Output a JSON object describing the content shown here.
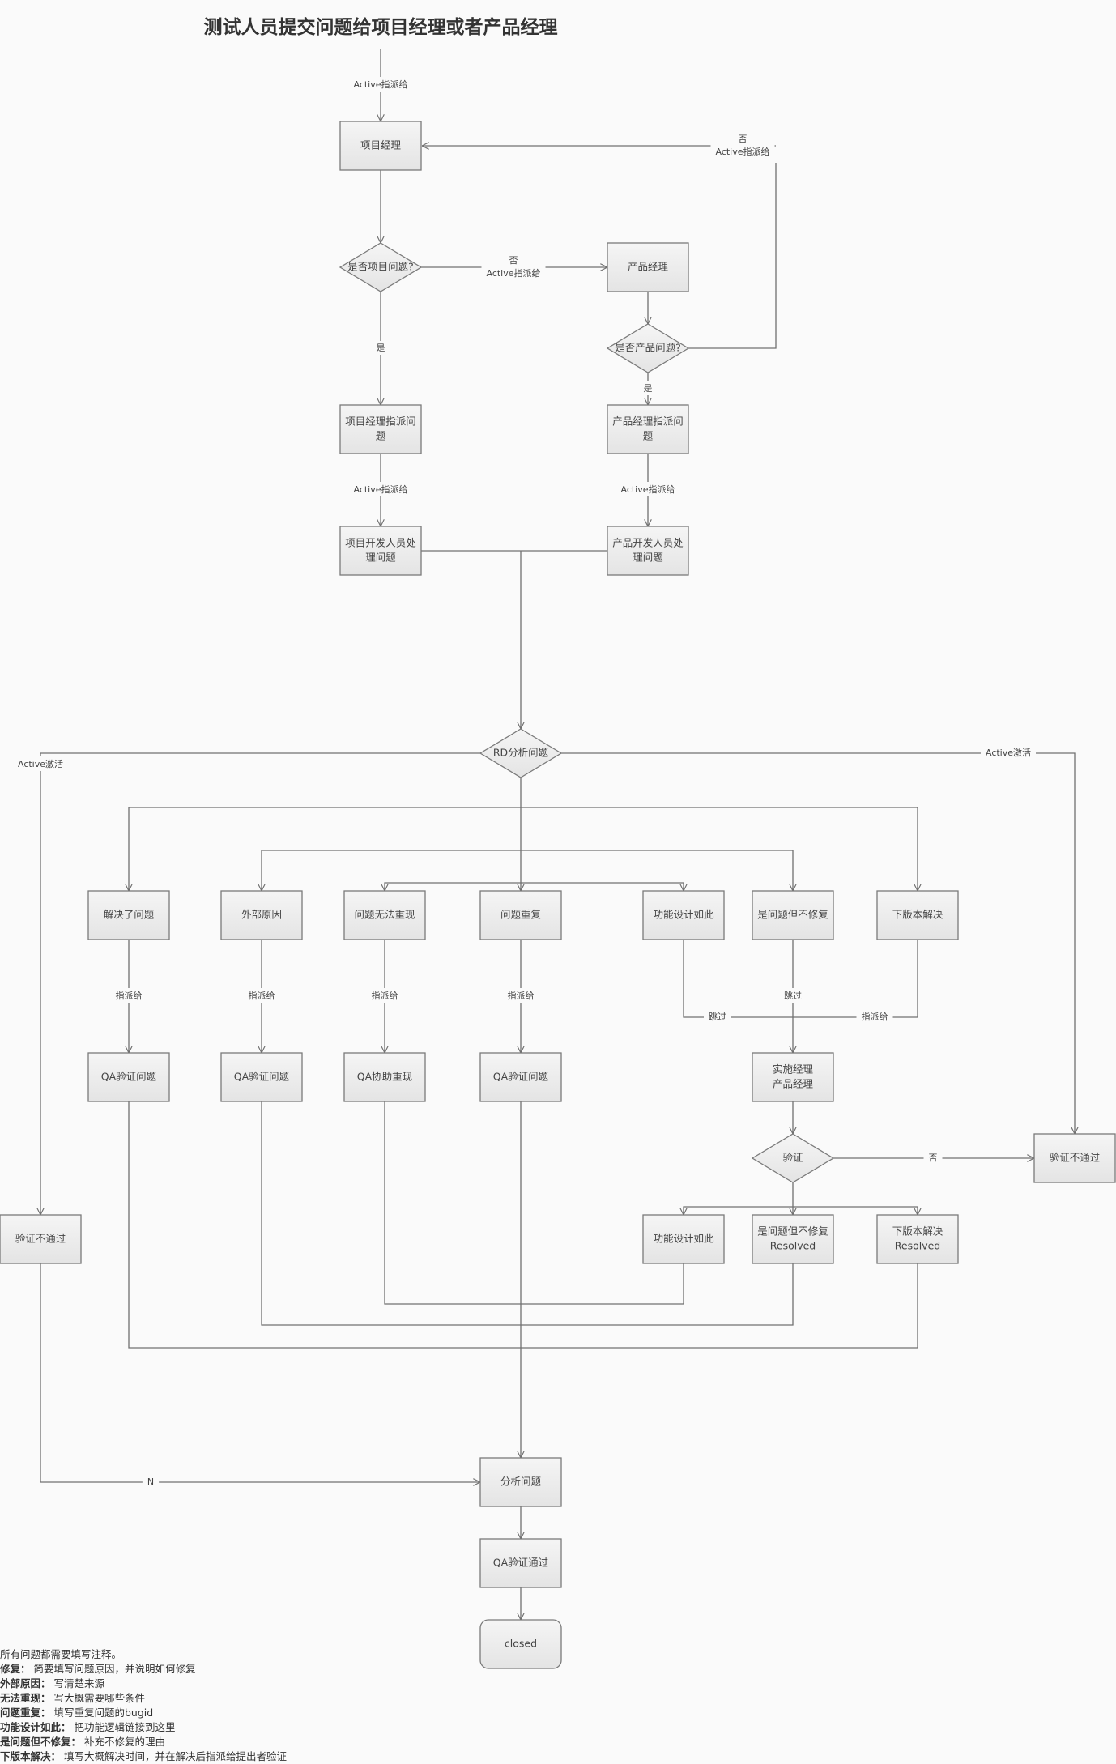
{
  "title": "测试人员提交问题给项目经理或者产品经理",
  "nodes": {
    "pm_project": {
      "label": "项目经理"
    },
    "is_project_issue": {
      "label": "是否项目问题?"
    },
    "pm_product": {
      "label": "产品经理"
    },
    "is_product_issue": {
      "label": "是否产品问题?"
    },
    "project_assign": {
      "label": "项目经理指派问题",
      "lines": [
        "项目经理指派问",
        "题"
      ]
    },
    "product_assign": {
      "label": "产品经理指派问题",
      "lines": [
        "产品经理指派问",
        "题"
      ]
    },
    "project_dev": {
      "label": "项目开发人员处理问题",
      "lines": [
        "项目开发人员处",
        "理问题"
      ]
    },
    "product_dev": {
      "label": "产品开发人员处理问题",
      "lines": [
        "产品开发人员处",
        "理问题"
      ]
    },
    "rd_analysis": {
      "label": "RD分析问题"
    },
    "resolved": {
      "label": "解决了问题"
    },
    "external": {
      "label": "外部原因"
    },
    "cannot_reproduce": {
      "label": "问题无法重现"
    },
    "duplicate": {
      "label": "问题重复"
    },
    "by_design": {
      "label": "功能设计如此"
    },
    "wont_fix": {
      "label": "是问题但不修复"
    },
    "next_version": {
      "label": "下版本解决"
    },
    "qa_verify_1": {
      "label": "QA验证问题"
    },
    "qa_verify_2": {
      "label": "QA验证问题"
    },
    "qa_reproduce": {
      "label": "QA协助重现"
    },
    "qa_verify_4": {
      "label": "QA验证问题"
    },
    "impl_manager": {
      "label": "实施经理 产品经理",
      "lines": [
        "实施经理",
        "产品经理"
      ]
    },
    "verify": {
      "label": "验证"
    },
    "verify_fail_right": {
      "label": "验证不通过"
    },
    "verify_fail_left": {
      "label": "验证不通过"
    },
    "by_design_2": {
      "label": "功能设计如此"
    },
    "wont_fix_resolved": {
      "label": "是问题但不修复 Resolved",
      "lines": [
        "是问题但不修复",
        "Resolved"
      ]
    },
    "next_version_resolved": {
      "label": "下版本解决 Resolved",
      "lines": [
        "下版本解决",
        "Resolved"
      ]
    },
    "analyze": {
      "label": "分析问题"
    },
    "qa_pass": {
      "label": "QA验证通过"
    },
    "closed": {
      "label": "closed"
    }
  },
  "edge_labels": {
    "start": "Active指派给",
    "project_no_1": "否",
    "project_no_2": "Active指派给",
    "product_no_1": "否",
    "product_no_2": "Active指派给",
    "project_yes": "是",
    "product_yes": "是",
    "project_assign_to": "Active指派给",
    "product_assign_to": "Active指派给",
    "reactivate_left": "Active激活",
    "reactivate_right": "Active激活",
    "assign_1": "指派给",
    "assign_2": "指派给",
    "assign_3": "指派给",
    "assign_4": "指派给",
    "skip_by_design": "跳过",
    "skip_wont_fix": "跳过",
    "assign_next_version": "指派给",
    "verify_no": "否",
    "reopen_n": "N"
  },
  "notes": {
    "intro": "所有问题都需要填写注释。",
    "items": [
      {
        "key": "修复",
        "text": "简要填写问题原因，并说明如何修复"
      },
      {
        "key": "外部原因",
        "text": "写清楚来源"
      },
      {
        "key": "无法重现",
        "text": "写大概需要哪些条件"
      },
      {
        "key": "问题重复",
        "text": "填写重复问题的bugid"
      },
      {
        "key": "功能设计如此",
        "text": "把功能逻辑链接到这里"
      },
      {
        "key": "是问题但不修复",
        "text": "补充不修复的理由"
      },
      {
        "key": "下版本解决",
        "text": "填写大概解决时间，并在解决后指派给提出者验证"
      }
    ],
    "separator": "："
  }
}
